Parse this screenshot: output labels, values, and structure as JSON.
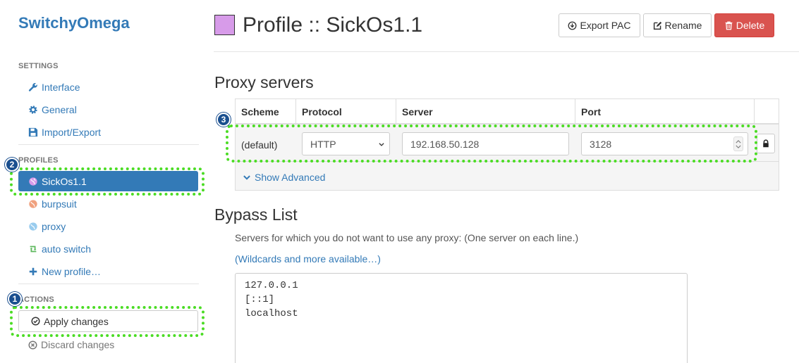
{
  "sidebar": {
    "brand": "SwitchyOmega",
    "settings_header": "SETTINGS",
    "settings_items": [
      {
        "label": "Interface",
        "icon": "wrench-icon"
      },
      {
        "label": "General",
        "icon": "gear-icon"
      },
      {
        "label": "Import/Export",
        "icon": "floppy-icon"
      }
    ],
    "profiles_header": "PROFILES",
    "profiles": [
      {
        "label": "SickOs1.1",
        "icon": "globe-icon",
        "color": "#d79be9",
        "active": true
      },
      {
        "label": "burpsuit",
        "icon": "globe-icon",
        "color": "#f0a17e"
      },
      {
        "label": "proxy",
        "icon": "globe-icon",
        "color": "#99ccee"
      },
      {
        "label": "auto switch",
        "icon": "retweet-icon",
        "color": "#5cb85c"
      },
      {
        "label": "New profile…",
        "icon": "plus-icon"
      }
    ],
    "actions_header": "ACTIONS",
    "apply_label": "Apply changes",
    "discard_label": "Discard changes"
  },
  "annotations": [
    "1",
    "2",
    "3"
  ],
  "header": {
    "title": "Profile :: SickOs1.1",
    "swatch_color": "#d79be9",
    "export_label": "Export PAC",
    "rename_label": "Rename",
    "delete_label": "Delete"
  },
  "proxy_servers": {
    "title": "Proxy servers",
    "columns": [
      "Scheme",
      "Protocol",
      "Server",
      "Port"
    ],
    "row": {
      "scheme": "(default)",
      "protocol": "HTTP",
      "server": "192.168.50.128",
      "port": "3128"
    },
    "show_advanced": "Show Advanced"
  },
  "bypass": {
    "title": "Bypass List",
    "help": "Servers for which you do not want to use any proxy: (One server on each line.)",
    "link": "(Wildcards and more available…)",
    "entries": "127.0.0.1\n[::1]\nlocalhost"
  },
  "colors": {
    "accent": "#337ab7",
    "danger": "#d9534f",
    "highlight": "#4bdc24"
  }
}
